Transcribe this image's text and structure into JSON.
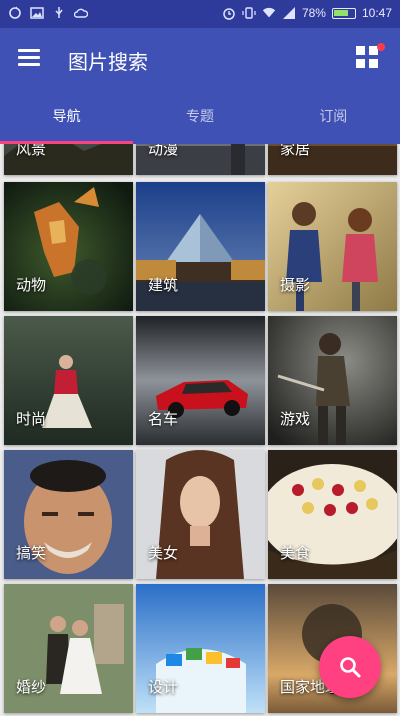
{
  "status_bar": {
    "battery_percent": "78%",
    "time": "10:47",
    "left_icons": [
      "sync-icon",
      "image-icon",
      "usb-icon",
      "cloud-icon"
    ],
    "right_icons": [
      "alarm-icon",
      "vibrate-icon",
      "wifi-icon",
      "signal-icon",
      "battery-icon"
    ]
  },
  "toolbar": {
    "title": "图片搜索",
    "menu_icon": "hamburger-menu-icon",
    "grid_icon": "grid-icon",
    "grid_has_notification": true
  },
  "tabs": [
    {
      "label": "导航",
      "active": true
    },
    {
      "label": "专题",
      "active": false
    },
    {
      "label": "订阅",
      "active": false
    }
  ],
  "categories": [
    {
      "label": "风景"
    },
    {
      "label": "动漫"
    },
    {
      "label": "家居"
    },
    {
      "label": "动物"
    },
    {
      "label": "建筑"
    },
    {
      "label": "摄影"
    },
    {
      "label": "时尚"
    },
    {
      "label": "名车"
    },
    {
      "label": "游戏"
    },
    {
      "label": "搞笑"
    },
    {
      "label": "美女"
    },
    {
      "label": "美食"
    },
    {
      "label": "婚纱"
    },
    {
      "label": "设计"
    },
    {
      "label": "国家地理"
    }
  ],
  "fab": {
    "icon": "search-icon"
  },
  "colors": {
    "primary": "#3f51b5",
    "status_bar": "#2f3b9b",
    "accent": "#ff4081"
  }
}
